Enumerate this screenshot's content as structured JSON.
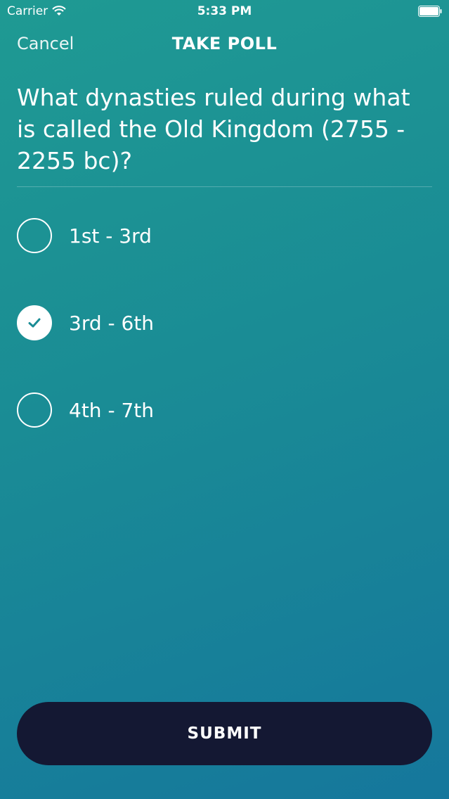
{
  "status_bar": {
    "carrier": "Carrier",
    "time": "5:33 PM",
    "icons": [
      "wifi-icon",
      "battery-icon"
    ]
  },
  "nav": {
    "cancel_label": "Cancel",
    "title": "TAKE POLL"
  },
  "poll": {
    "question": "What dynasties ruled during what is called the Old Kingdom (2755 - 2255 bc)?",
    "options": [
      {
        "label": "1st - 3rd",
        "selected": false
      },
      {
        "label": "3rd - 6th",
        "selected": true
      },
      {
        "label": "4th - 7th",
        "selected": false
      }
    ],
    "submit_label": "SUBMIT"
  },
  "colors": {
    "accent": "#1a8c95",
    "button_bg": "#141833",
    "check": "#1a8c95"
  }
}
